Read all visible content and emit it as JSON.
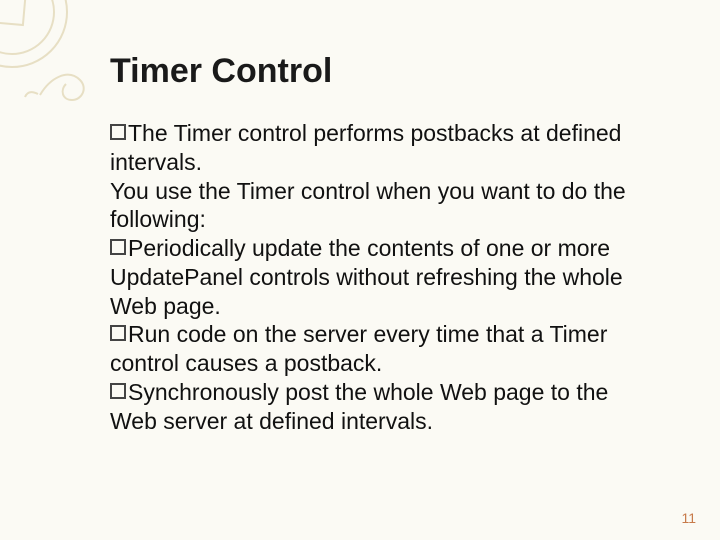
{
  "slide": {
    "title": "Timer Control",
    "bullets": [
      "The Timer control performs postbacks at defined intervals.",
      "You use the Timer control when you want to do the following:",
      "Periodically update the contents of one or more UpdatePanel controls without refreshing the whole Web page.",
      "Run code on the server every time that a Timer control causes a postback.",
      "Synchronously post the whole Web page to the Web server at defined intervals."
    ],
    "page_number": "11"
  }
}
